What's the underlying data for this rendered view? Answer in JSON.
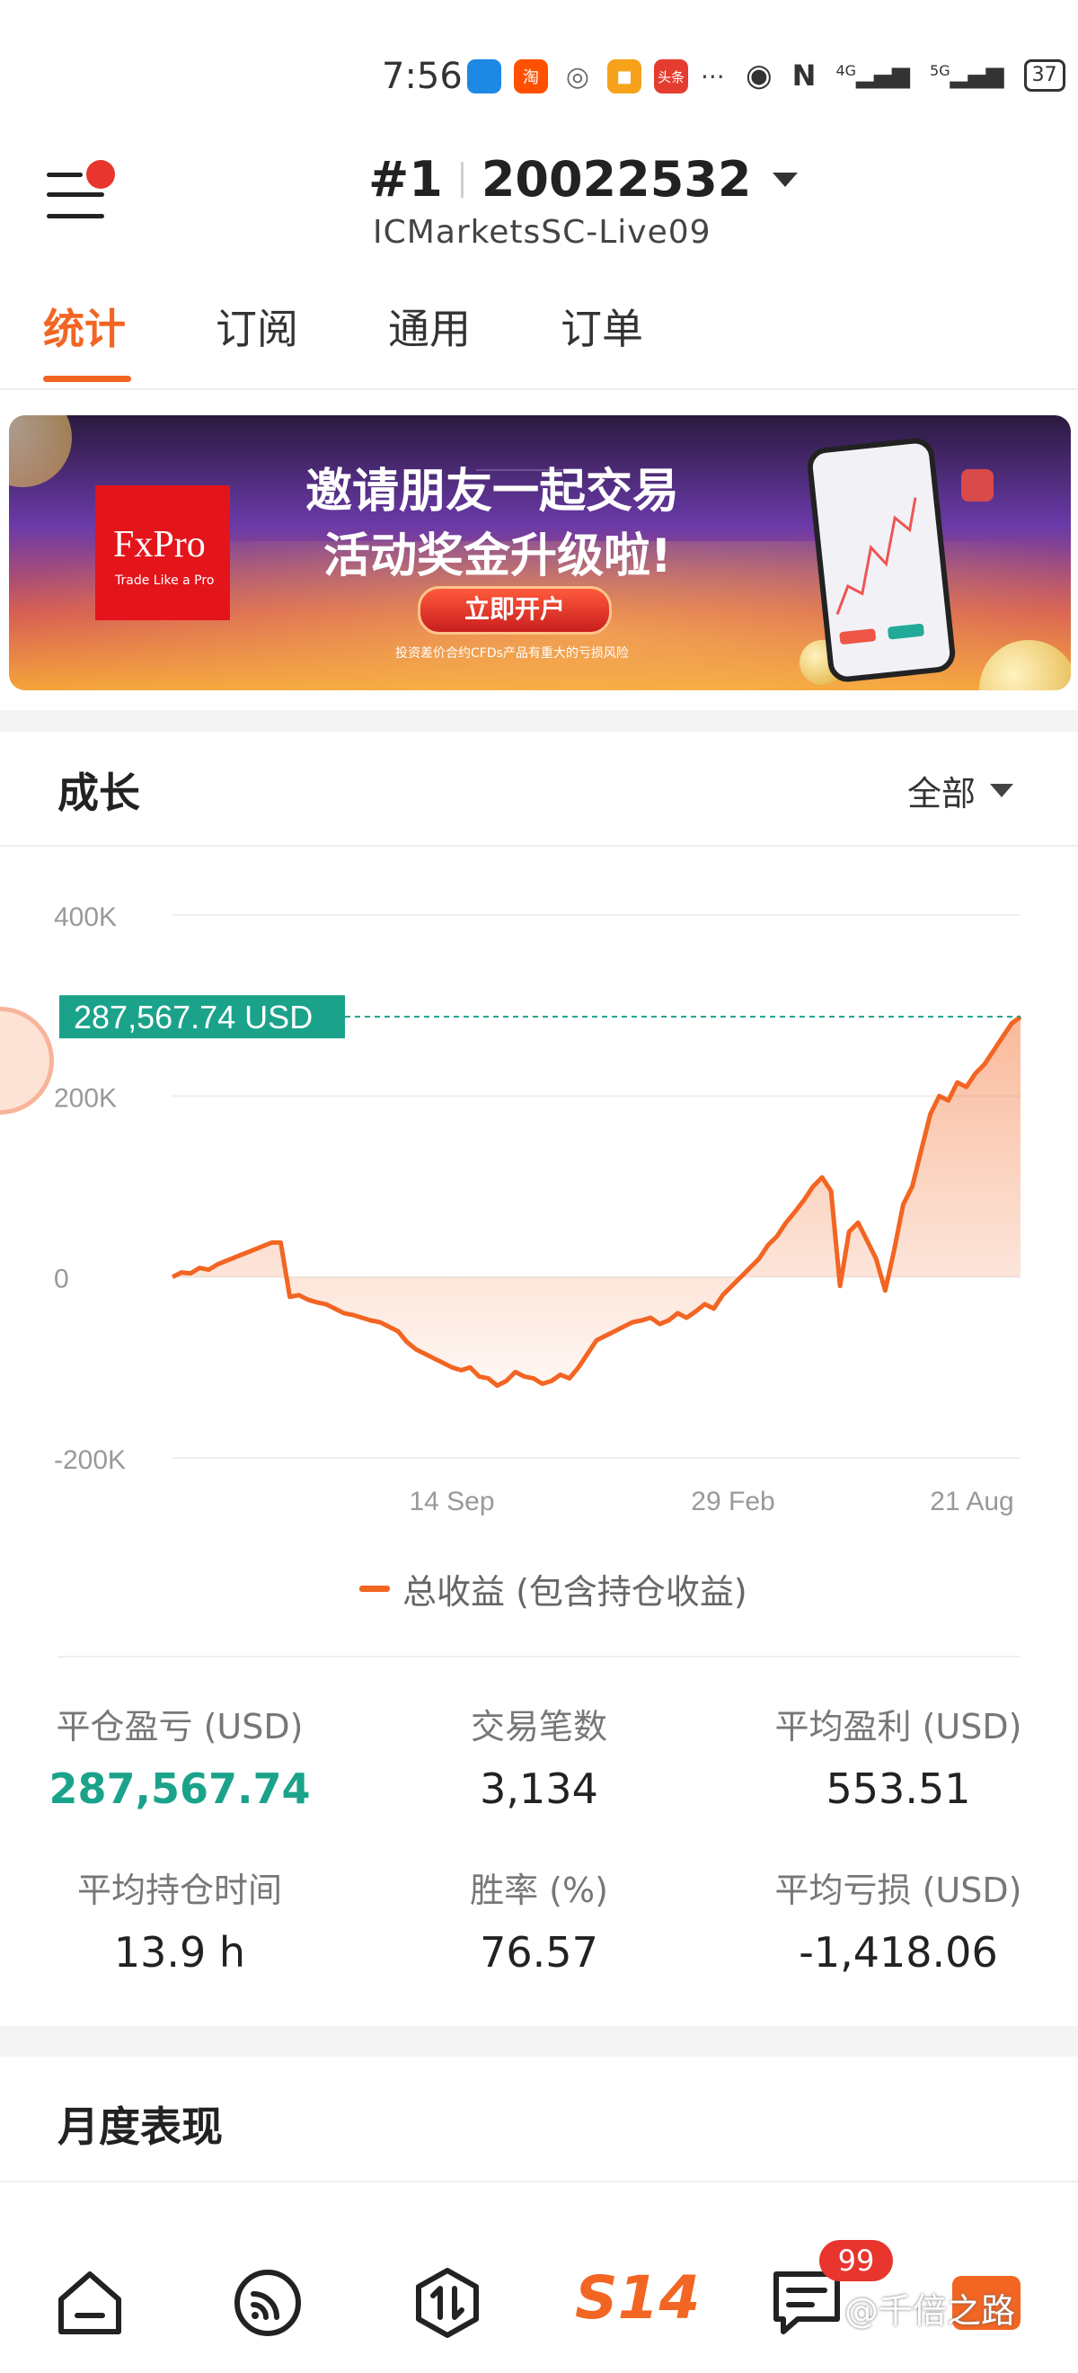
{
  "status_bar": {
    "time": "7:56",
    "apps": [
      {
        "label": "汽车之家",
        "color": "#1e88e5"
      },
      {
        "label": "淘",
        "color": "#ff5000"
      },
      {
        "label": "◎",
        "color": "#7a7a7a"
      },
      {
        "label": "■",
        "color": "#f7a21b"
      },
      {
        "label": "头条",
        "color": "#e43d30"
      }
    ],
    "more": "···",
    "network_left": "4G",
    "network_right": "5G",
    "battery": "37"
  },
  "header": {
    "rank": "#1",
    "account": "20022532",
    "server": "ICMarketsSC-Live09"
  },
  "tabs": [
    "统计",
    "订阅",
    "通用",
    "订单"
  ],
  "banner": {
    "brand": "FxPro",
    "tagline": "Trade Like a Pro",
    "line1": "邀请朋友一起交易",
    "line2": "活动奖金升级啦!",
    "cta": "立即开户",
    "disclaimer": "投资差价合约CFDs产品有重大的亏损风险"
  },
  "growth": {
    "title": "成长",
    "filter": "全部",
    "legend": "总收益 (包含持仓收益)"
  },
  "chart_data": {
    "type": "area",
    "y_ticks": [
      "400K",
      "200K",
      "0",
      "-200K"
    ],
    "ylim": [
      -200000,
      400000
    ],
    "x_ticks": [
      "14 Sep",
      "29 Feb",
      "21 Aug"
    ],
    "current_value_label": "287,567.74 USD",
    "current_value": 287567.74,
    "series": [
      {
        "color": "#f26522",
        "values": [
          0,
          5000,
          4000,
          10000,
          8000,
          14000,
          18000,
          22000,
          26000,
          30000,
          34000,
          38000,
          38000,
          -22000,
          -20000,
          -25000,
          -28000,
          -30000,
          -35000,
          -40000,
          -42000,
          -45000,
          -48000,
          -50000,
          -55000,
          -60000,
          -72000,
          -80000,
          -85000,
          -90000,
          -95000,
          -100000,
          -103000,
          -100000,
          -110000,
          -112000,
          -120000,
          -115000,
          -105000,
          -110000,
          -112000,
          -118000,
          -115000,
          -108000,
          -112000,
          -100000,
          -85000,
          -70000,
          -65000,
          -60000,
          -55000,
          -50000,
          -48000,
          -45000,
          -52000,
          -48000,
          -40000,
          -45000,
          -38000,
          -30000,
          -35000,
          -20000,
          -10000,
          0,
          10000,
          20000,
          35000,
          45000,
          60000,
          72000,
          85000,
          100000,
          110000,
          95000,
          -10000,
          50000,
          60000,
          40000,
          20000,
          -15000,
          30000,
          80000,
          100000,
          140000,
          180000,
          200000,
          195000,
          215000,
          210000,
          225000,
          235000,
          250000,
          265000,
          280000,
          287567.74
        ]
      }
    ]
  },
  "stats": [
    {
      "label": "平仓盈亏 (USD)",
      "value": "287,567.74",
      "highlight": true
    },
    {
      "label": "交易笔数",
      "value": "3,134"
    },
    {
      "label": "平均盈利 (USD)",
      "value": "553.51"
    },
    {
      "label": "平均持仓时间",
      "value": "13.9 h"
    },
    {
      "label": "胜率 (%)",
      "value": "76.57"
    },
    {
      "label": "平均亏损 (USD)",
      "value": "-1,418.06"
    }
  ],
  "monthly": {
    "title": "月度表现"
  },
  "bottom_nav": {
    "items": [
      "home-icon",
      "signals-icon",
      "trade-icon",
      "s14-logo",
      "messages-icon",
      "profile-icon"
    ],
    "s14_label": "S14",
    "messages_badge": "99",
    "watermark": "@千倍之路"
  }
}
